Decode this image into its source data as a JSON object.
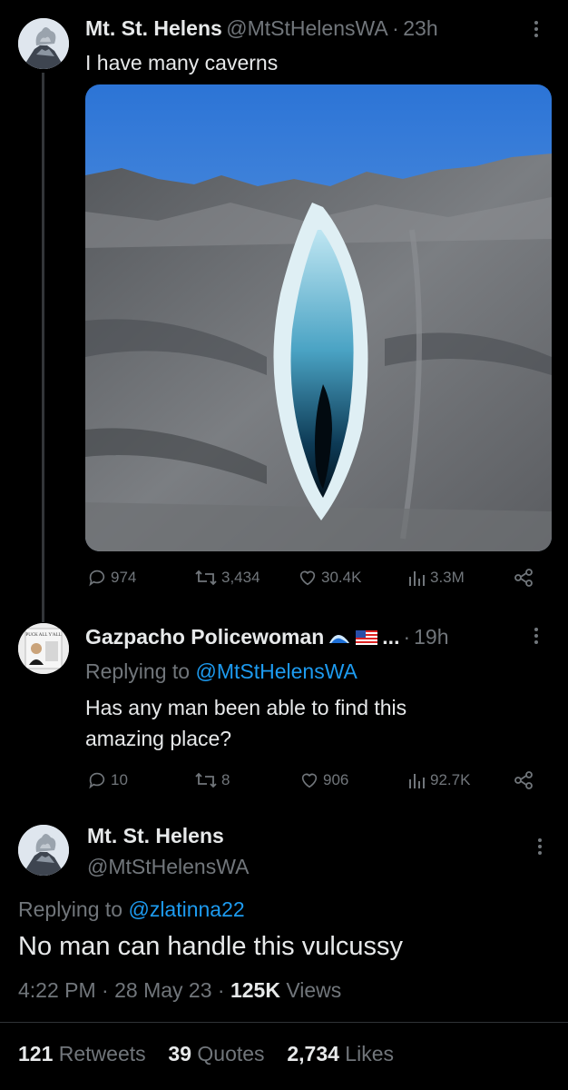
{
  "tweet1": {
    "author_name": "Mt. St. Helens",
    "author_handle": "@MtStHelensWA",
    "separator": "·",
    "time": "23h",
    "text": "I have many caverns",
    "replies": "974",
    "retweets": "3,434",
    "likes": "30.4K",
    "views": "3.3M"
  },
  "reply": {
    "author_name": "Gazpacho Policewoman",
    "author_suffix": "...",
    "separator": "·",
    "time": "19h",
    "replying_label": "Replying to",
    "replying_to": "@MtStHelensWA",
    "text_line1": "Has any man been able to find this",
    "text_line2": "amazing place?",
    "replies": "10",
    "retweets": "8",
    "likes": "906",
    "views": "92.7K",
    "avatar_text": "PUCK ALL Y'ALL"
  },
  "main_tweet": {
    "author_name": "Mt. St. Helens",
    "author_handle": "@MtStHelensWA",
    "replying_label": "Replying to",
    "replying_to": "@zlatinna22",
    "text": "No man can handle this vulcussy",
    "time": "4:22 PM",
    "date": "28 May 23",
    "sep1": "·",
    "sep2": "·",
    "views_count": "125K",
    "views_label": "Views",
    "retweets_count": "121",
    "retweets_label": "Retweets",
    "quotes_count": "39",
    "quotes_label": "Quotes",
    "likes_count": "2,734",
    "likes_label": "Likes"
  },
  "colors": {
    "background": "#000000",
    "text": "#e7e9ea",
    "muted": "#71767b",
    "link": "#1d9bf0"
  }
}
